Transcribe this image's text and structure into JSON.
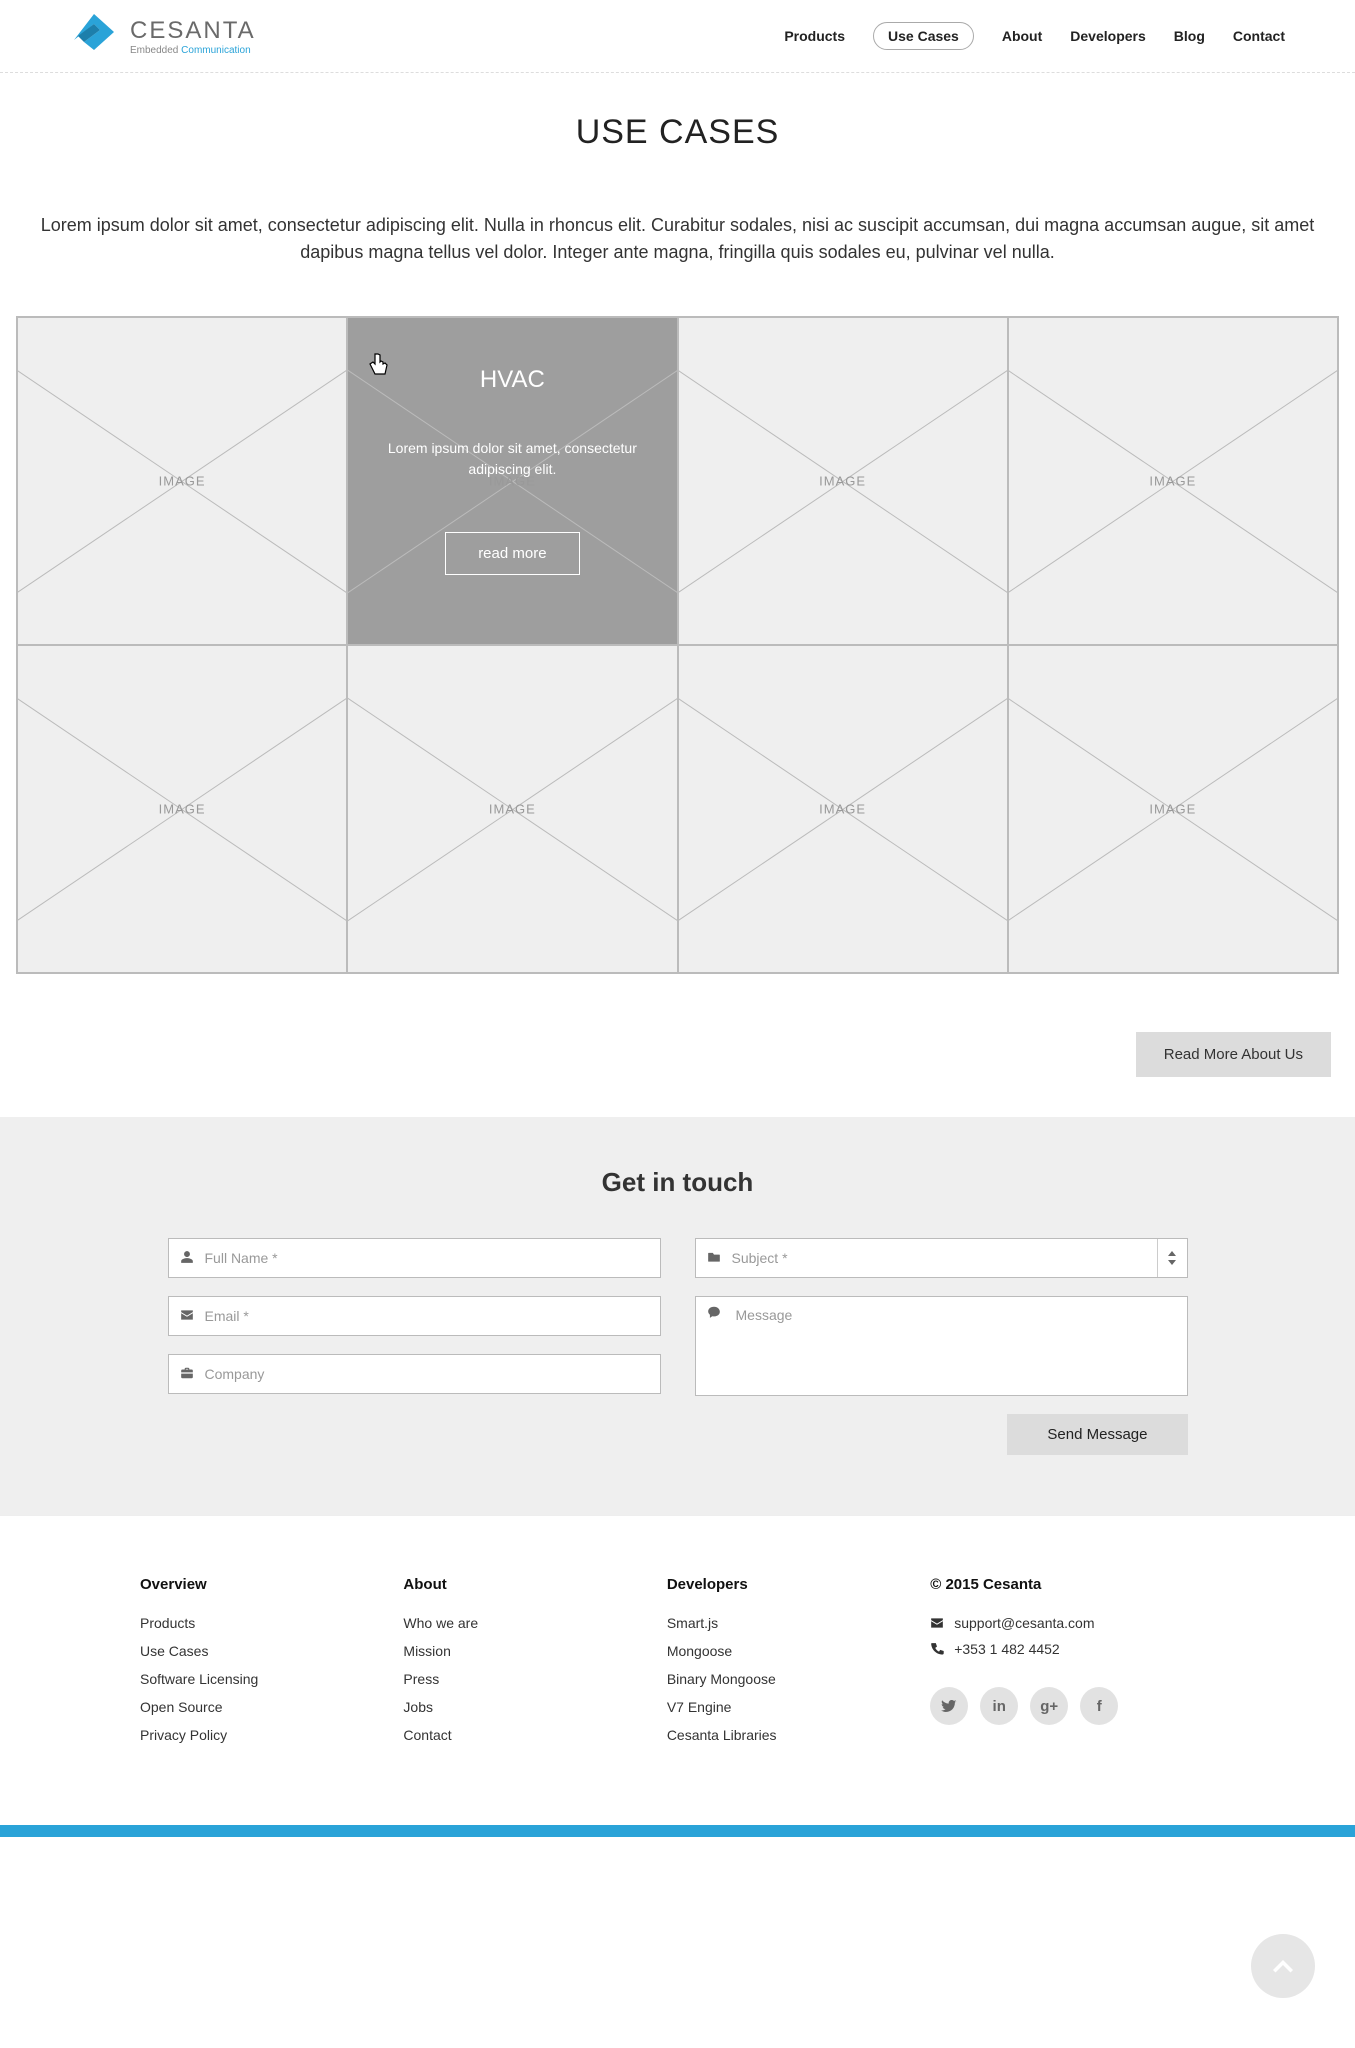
{
  "brand": {
    "name": "CESANTA",
    "tagline_prefix": "Embedded ",
    "tagline_accent": "Communication"
  },
  "nav": {
    "items": [
      "Products",
      "Use Cases",
      "About",
      "Developers",
      "Blog",
      "Contact"
    ],
    "active_index": 1
  },
  "page": {
    "title": "USE CASES",
    "intro": "Lorem ipsum dolor sit amet, consectetur adipiscing elit. Nulla in rhoncus elit. Curabitur sodales, nisi ac suscipit accumsan, dui magna accumsan augue, sit amet dapibus magna tellus vel dolor. Integer ante magna, fringilla quis sodales eu, pulvinar vel nulla."
  },
  "grid": {
    "placeholder_label": "IMAGE",
    "hover": {
      "title": "HVAC",
      "desc": "Lorem ipsum dolor sit amet, consectetur adipiscing elit.",
      "button": "read more"
    }
  },
  "readmore_button": "Read More About Us",
  "contact": {
    "title": "Get in touch",
    "name_placeholder": "Full Name *",
    "email_placeholder": "Email *",
    "company_placeholder": "Company",
    "subject_placeholder": "Subject *",
    "message_placeholder": "Message",
    "send_button": "Send Message"
  },
  "footer": {
    "columns": [
      {
        "title": "Overview",
        "links": [
          "Products",
          "Use Cases",
          "Software Licensing",
          "Open Source",
          "Privacy Policy"
        ]
      },
      {
        "title": "About",
        "links": [
          "Who we are",
          "Mission",
          "Press",
          "Jobs",
          "Contact"
        ]
      },
      {
        "title": "Developers",
        "links": [
          "Smart.js",
          "Mongoose",
          "Binary Mongoose",
          "V7 Engine",
          "Cesanta Libraries"
        ]
      }
    ],
    "copyright": "© 2015 Cesanta",
    "email": "support@cesanta.com",
    "phone": "+353 1 482 4452",
    "socials": [
      "twitter",
      "linkedin",
      "google-plus",
      "facebook"
    ]
  }
}
